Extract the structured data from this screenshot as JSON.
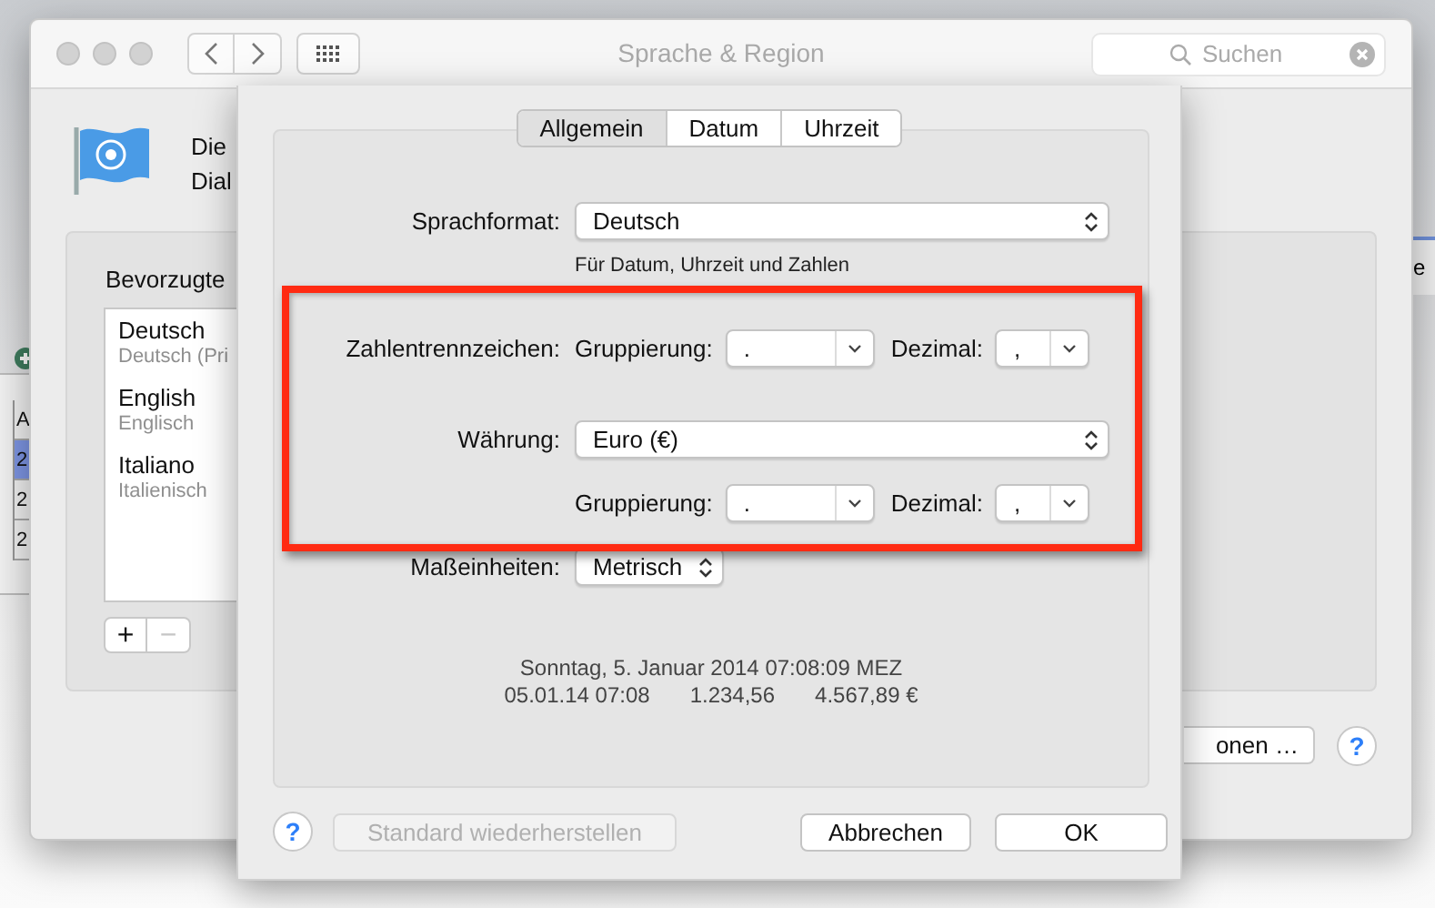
{
  "background_window": {
    "header": "A",
    "rows": [
      {
        "text": "2",
        "selected": true
      },
      {
        "text": "2",
        "selected": false
      },
      {
        "text": "2",
        "selected": false
      }
    ],
    "right_text": "e"
  },
  "window": {
    "title": "Sprache & Region",
    "search": {
      "placeholder": "Suchen"
    },
    "intro_lines": [
      "Die",
      "Dial"
    ],
    "help_button": "?",
    "preferred_languages": {
      "heading": "Bevorzugte",
      "items": [
        {
          "name": "Deutsch",
          "subtitle": "Deutsch (Pri"
        },
        {
          "name": "English",
          "subtitle": "Englisch"
        },
        {
          "name": "Italiano",
          "subtitle": "Italienisch"
        }
      ]
    },
    "list_buttons": [
      {
        "label": "+",
        "disabled": false
      },
      {
        "label": "−",
        "disabled": true
      }
    ],
    "options_button": "onen …"
  },
  "sheet": {
    "help_button": "?",
    "tabs": [
      {
        "label": "Allgemein",
        "selected": true
      },
      {
        "label": "Datum",
        "selected": false
      },
      {
        "label": "Uhrzeit",
        "selected": false
      }
    ],
    "language_format": {
      "label": "Sprachformat:",
      "popup": {
        "value": "Deutsch",
        "kind": "updown"
      },
      "note": "Für Datum, Uhrzeit und Zahlen"
    },
    "number_separators": {
      "label": "Zahlentrennzeichen:",
      "grouping_label": "Gruppierung:",
      "grouping": {
        "value": ".",
        "kind": "down"
      },
      "decimal_label": "Dezimal:",
      "decimal": {
        "value": ",",
        "kind": "down"
      }
    },
    "currency": {
      "label": "Währung:",
      "popup": {
        "value": "Euro (€)",
        "kind": "updown"
      },
      "grouping_label": "Gruppierung:",
      "grouping": {
        "value": ".",
        "kind": "down"
      },
      "decimal_label": "Dezimal:",
      "decimal": {
        "value": ",",
        "kind": "down"
      }
    },
    "units": {
      "label": "Maßeinheiten:",
      "popup": {
        "value": "Metrisch",
        "kind": "updown"
      }
    },
    "preview": {
      "line_1": "Sonntag, 5. Januar 2014 07:08:09 MEZ",
      "line_2": [
        "05.01.14 07:08",
        "1.234,56",
        "4.567,89 €"
      ]
    },
    "buttons": [
      {
        "label": "Standard wiederherstellen",
        "disabled": true
      },
      {
        "label": "Abbrechen",
        "disabled": false
      },
      {
        "label": "OK",
        "disabled": false
      }
    ]
  }
}
